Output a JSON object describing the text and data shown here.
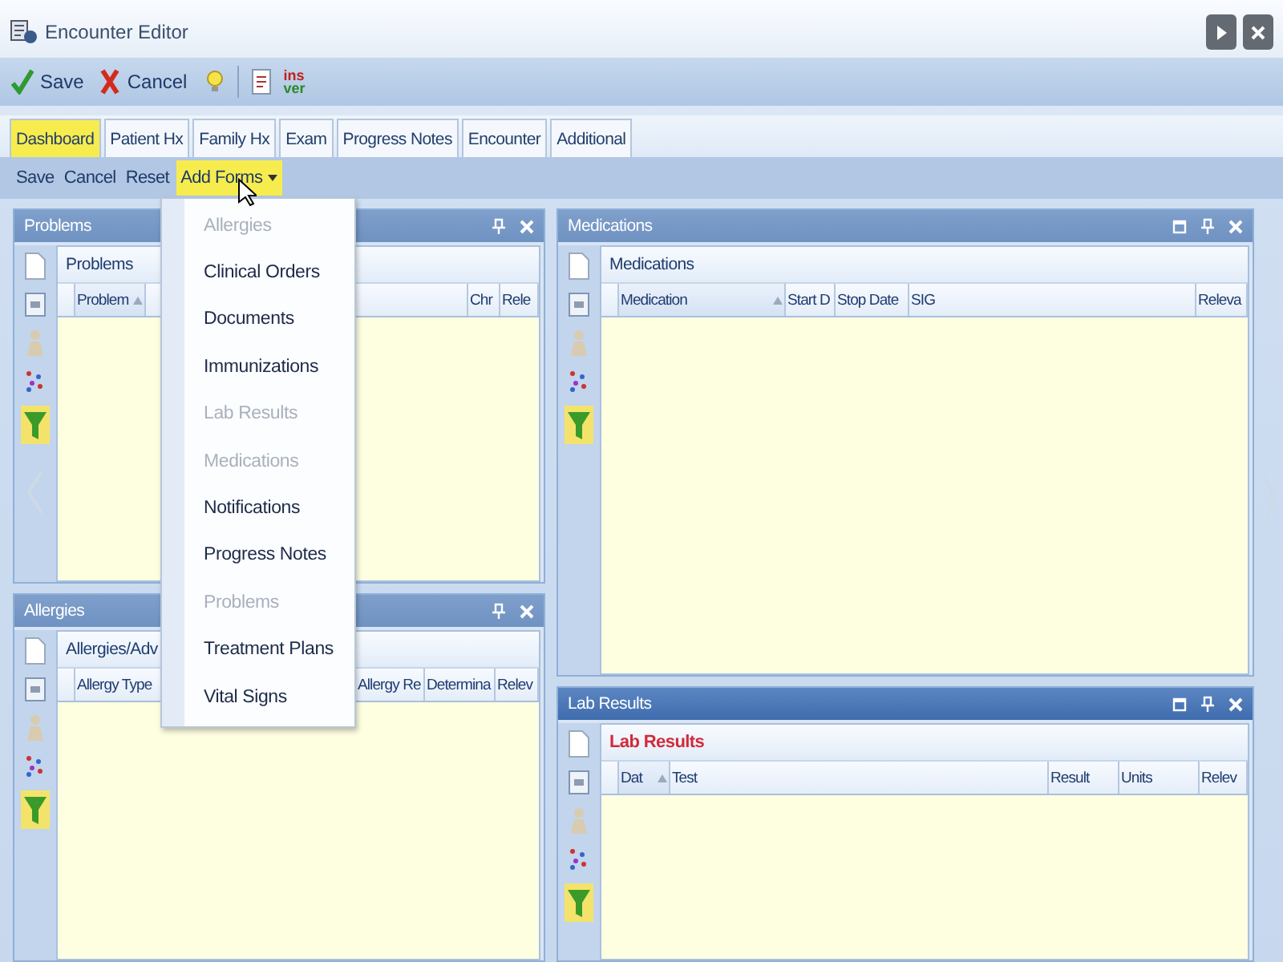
{
  "window": {
    "title": "Encounter Editor"
  },
  "toolbar": [
    {
      "kind": "save",
      "label": "Save"
    },
    {
      "kind": "cancel",
      "label": "Cancel"
    },
    {
      "kind": "bulb"
    },
    {
      "kind": "document"
    },
    {
      "kind": "insver",
      "top": "ins",
      "bottom": "ver"
    }
  ],
  "tabs": [
    {
      "label": "Dashboard",
      "selected": true
    },
    {
      "label": "Patient Hx",
      "selected": false
    },
    {
      "label": "Family Hx",
      "selected": false
    },
    {
      "label": "Exam",
      "selected": false
    },
    {
      "label": "Progress Notes",
      "selected": false
    },
    {
      "label": "Encounter",
      "selected": false
    },
    {
      "label": "Additional",
      "selected": false
    }
  ],
  "subtoolbar": [
    {
      "label": "Save",
      "kind": "button",
      "open": false
    },
    {
      "label": "Cancel",
      "kind": "button",
      "open": false
    },
    {
      "label": "Reset",
      "kind": "button",
      "open": false
    },
    {
      "label": "Add Forms",
      "kind": "dropdown",
      "open": true
    }
  ],
  "panels_left": [
    {
      "title": "Problems",
      "active": false,
      "maximize": false,
      "subtitle": "Problems",
      "subtitle_alert": false,
      "columns": [
        {
          "label": "Problem",
          "sorted": true
        },
        {
          "label": "Chr",
          "sorted": false
        },
        {
          "label": "Rele",
          "sorted": false
        }
      ]
    },
    {
      "title": "Allergies",
      "active": false,
      "maximize": false,
      "subtitle": "Allergies/Adv",
      "subtitle_alert": false,
      "columns": [
        {
          "label": "Allergy Type",
          "sorted": false
        },
        {
          "label": "Allergy Re",
          "sorted": false
        },
        {
          "label": "Determina",
          "sorted": false
        },
        {
          "label": "Relev",
          "sorted": false
        }
      ]
    }
  ],
  "panels_right": [
    {
      "title": "Medications",
      "active": false,
      "maximize": true,
      "subtitle": "Medications",
      "subtitle_alert": false,
      "columns": [
        {
          "label": "Medication",
          "sorted": true
        },
        {
          "label": "Start D",
          "sorted": false
        },
        {
          "label": "Stop Date",
          "sorted": false
        },
        {
          "label": "SIG",
          "sorted": false
        },
        {
          "label": "Releva",
          "sorted": false
        }
      ]
    },
    {
      "title": "Lab Results",
      "active": true,
      "maximize": true,
      "subtitle": "Lab Results",
      "subtitle_alert": true,
      "columns": [
        {
          "label": "Dat",
          "sorted": true
        },
        {
          "label": "Test",
          "sorted": false
        },
        {
          "label": "Result",
          "sorted": false
        },
        {
          "label": "Units",
          "sorted": false
        },
        {
          "label": "Relev",
          "sorted": false
        }
      ]
    }
  ],
  "add_forms_menu": {
    "items": [
      {
        "label": "Allergies",
        "disabled": true
      },
      {
        "label": "Clinical Orders",
        "disabled": false
      },
      {
        "label": "Documents",
        "disabled": false
      },
      {
        "label": "Immunizations",
        "disabled": false
      },
      {
        "label": "Lab Results",
        "disabled": true
      },
      {
        "label": "Medications",
        "disabled": true
      },
      {
        "label": "Notifications",
        "disabled": false
      },
      {
        "label": "Progress Notes",
        "disabled": false
      },
      {
        "label": "Problems",
        "disabled": true
      },
      {
        "label": "Treatment Plans",
        "disabled": false
      },
      {
        "label": "Vital Signs",
        "disabled": false
      }
    ]
  }
}
